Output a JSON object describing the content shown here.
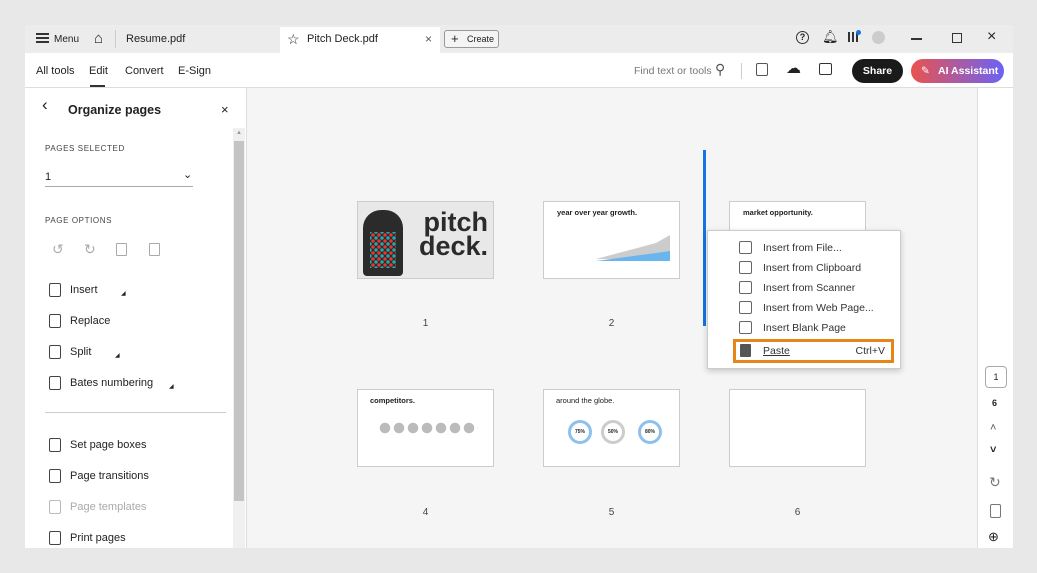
{
  "tabs": {
    "menu": "Menu",
    "resume": "Resume.pdf",
    "active": "Pitch Deck.pdf",
    "create": "Create"
  },
  "toolbar": {
    "nav": [
      "All tools",
      "Edit",
      "Convert",
      "E-Sign"
    ],
    "search_placeholder": "Find text or tools",
    "share": "Share",
    "ai": "AI Assistant"
  },
  "panel": {
    "title": "Organize pages",
    "pages_selected_label": "PAGES SELECTED",
    "pages_selected_value": "1",
    "page_options_label": "PAGE OPTIONS",
    "options": [
      "Insert",
      "Replace",
      "Split",
      "Bates numbering"
    ],
    "options2": [
      "Set page boxes",
      "Page transitions",
      "Page templates",
      "Print pages"
    ]
  },
  "thumbs": [
    {
      "num": "1",
      "title": "pitch deck."
    },
    {
      "num": "2",
      "title": "year over year growth."
    },
    {
      "num": "3",
      "title": "market opportunity."
    },
    {
      "num": "4",
      "title": "competitors."
    },
    {
      "num": "5",
      "title": "around the globe.",
      "stats": [
        "75%",
        "50%",
        "80%"
      ]
    },
    {
      "num": "6",
      "title": ""
    }
  ],
  "context_menu": {
    "items": [
      "Insert from File...",
      "Insert from Clipboard",
      "Insert from Scanner",
      "Insert from Web Page...",
      "Insert Blank Page"
    ],
    "paste": "Paste",
    "paste_shortcut": "Ctrl+V"
  },
  "rail": {
    "current_page": "1",
    "total_pages": "6"
  },
  "colors": {
    "accent": "#1473e6",
    "highlight": "#e68619",
    "share_bg": "#1a1a1a"
  }
}
